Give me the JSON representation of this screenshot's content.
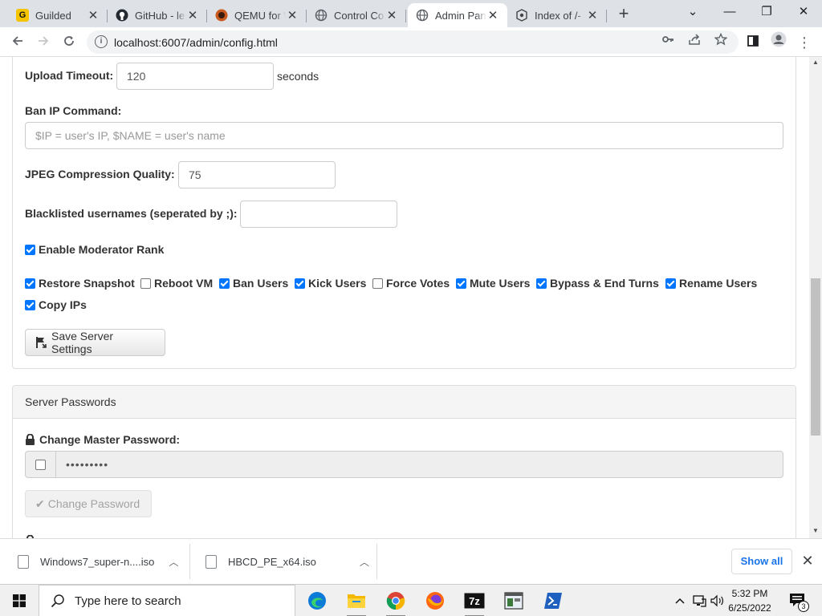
{
  "browser": {
    "tabs": [
      {
        "title": "Guilded",
        "favicon": "guilded-icon",
        "active": false
      },
      {
        "title": "GitHub - le",
        "favicon": "github-icon",
        "active": false
      },
      {
        "title": "QEMU for W",
        "favicon": "qemu-icon",
        "active": false
      },
      {
        "title": "Control Co",
        "favicon": "globe-icon",
        "active": false
      },
      {
        "title": "Admin Pan",
        "favicon": "globe-icon",
        "active": true
      },
      {
        "title": "Index of /-",
        "favicon": "index-icon",
        "active": false
      }
    ],
    "url": "localhost:6007/admin/config.html"
  },
  "settings": {
    "upload_timeout_label": "Upload Timeout:",
    "upload_timeout_value": "120",
    "upload_timeout_unit": "seconds",
    "ban_ip_label": "Ban IP Command:",
    "ban_ip_placeholder": "$IP = user's IP, $NAME = user's name",
    "jpeg_label": "JPEG Compression Quality:",
    "jpeg_value": "75",
    "blacklist_label": "Blacklisted usernames (seperated by ;):",
    "blacklist_value": "",
    "enable_mod_rank_label": "Enable Moderator Rank",
    "enable_mod_rank_checked": true,
    "permissions": [
      {
        "label": "Restore Snapshot",
        "checked": true
      },
      {
        "label": "Reboot VM",
        "checked": false
      },
      {
        "label": "Ban Users",
        "checked": true
      },
      {
        "label": "Kick Users",
        "checked": true
      },
      {
        "label": "Force Votes",
        "checked": false
      },
      {
        "label": "Mute Users",
        "checked": true
      },
      {
        "label": "Bypass & End Turns",
        "checked": true
      },
      {
        "label": "Rename Users",
        "checked": true
      },
      {
        "label": "Copy IPs",
        "checked": true
      }
    ],
    "save_button_label": "Save Server Settings"
  },
  "passwords": {
    "panel_title": "Server Passwords",
    "master_label": "Change Master Password:",
    "master_value": "•••••••••",
    "master_show_checked": false,
    "change_button_label": "Change Password"
  },
  "downloads": {
    "items": [
      {
        "name": "Windows7_super-n....iso"
      },
      {
        "name": "HBCD_PE_x64.iso"
      }
    ],
    "show_all_label": "Show all"
  },
  "taskbar": {
    "search_placeholder": "Type here to search",
    "time": "5:32 PM",
    "date": "6/25/2022",
    "notification_count": "3",
    "apps": [
      "edge-icon",
      "file-explorer-icon",
      "chrome-icon",
      "firefox-icon",
      "7zip-icon",
      "app-window-icon",
      "powershell-icon"
    ]
  },
  "colors": {
    "checkbox_accent": "#0075ff",
    "link_blue": "#1a73e8",
    "panel_heading_bg": "#f5f5f5"
  }
}
